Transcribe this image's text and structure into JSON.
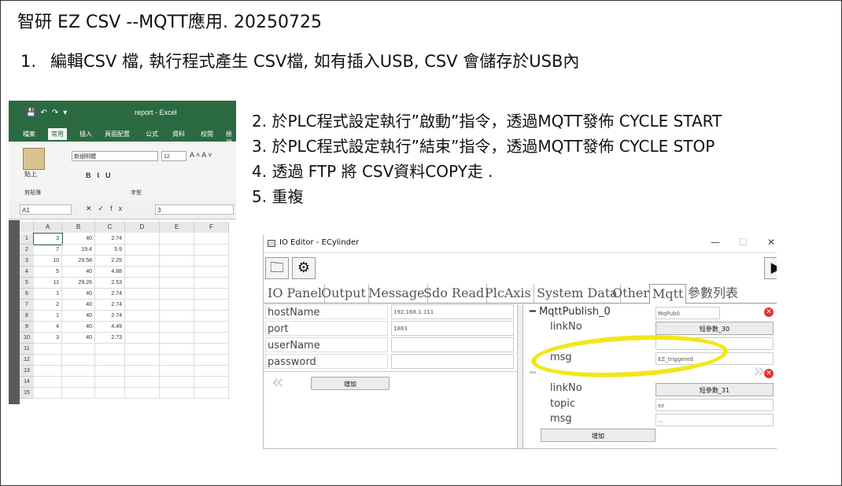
{
  "slide": {
    "title": "智研 EZ  CSV  --MQTT應用.  20250725",
    "step1_num": "1.",
    "step1_text": "編輯CSV 檔,  執行程式產生 CSV檔, 如有插入USB,  CSV 會儲存於USB內",
    "steps": [
      "2. 於PLC程式設定執行”啟動”指令，透過MQTT發佈   CYCLE START",
      "3. 於PLC程式設定執行”結束”指令，透過MQTT發佈   CYCLE STOP",
      "4. 透過 FTP  將 CSV資料COPY走 .",
      "5. 重複"
    ]
  },
  "excel": {
    "window_title": "report - Excel",
    "tabs": [
      "檔案",
      "常用",
      "插入",
      "頁面配置",
      "公式",
      "資料",
      "校閱",
      "檢視"
    ],
    "active_tab": "常用",
    "paste_label": "貼上",
    "clipboard_label": "剪貼簿",
    "font_group_label": "字型",
    "font_name": "新細明體",
    "font_size": "12",
    "name_box": "A1",
    "formula_value": "3",
    "columns": [
      "A",
      "B",
      "C",
      "D",
      "E",
      "F"
    ],
    "row_numbers": [
      "1",
      "2",
      "3",
      "4",
      "5",
      "6",
      "7",
      "8",
      "9",
      "10",
      "11",
      "12",
      "13",
      "14",
      "15"
    ],
    "rows": [
      [
        "3",
        "40",
        "2.74"
      ],
      [
        "7",
        "19.4",
        "5.9"
      ],
      [
        "10",
        "29.58",
        "2.25"
      ],
      [
        "5",
        "40",
        "4.88"
      ],
      [
        "11",
        "29.26",
        "2.53"
      ],
      [
        "1",
        "40",
        "2.74"
      ],
      [
        "2",
        "40",
        "2.74"
      ],
      [
        "1",
        "40",
        "2.74"
      ],
      [
        "4",
        "40",
        "4.49"
      ],
      [
        "3",
        "40",
        "2.73"
      ]
    ]
  },
  "io_editor": {
    "window_title": "IO Editor - ECylinder",
    "tabs": [
      "IO Panel",
      "Output",
      "Message",
      "Sdo Read",
      "PlcAxis",
      "System Data",
      "Other",
      "Mqtt",
      "參數列表"
    ],
    "active_tab": "Mqtt",
    "connection": [
      {
        "label": "hostName",
        "value": "192.168.1.111"
      },
      {
        "label": "port",
        "value": "1883"
      },
      {
        "label": "userName",
        "value": ""
      },
      {
        "label": "password",
        "value": ""
      }
    ],
    "add_label": "增加",
    "publish0": {
      "header": "MqttPublish_0",
      "name_value": "MqPub0",
      "linkNo_label": "linkNo",
      "linkNo_button": "短參數_30",
      "msg_label": "msg",
      "msg_value": "EZ_triggered"
    },
    "publish1": {
      "linkNo_label": "linkNo",
      "linkNo_button": "短參數_31",
      "topic_label": "topic",
      "topic_value": "ez",
      "msg_label": "msg",
      "msg_value": "..."
    }
  },
  "colors": {
    "excel_green": "#2b6a40",
    "highlight_yellow": "#f3e61a",
    "delete_red": "#e03333"
  }
}
